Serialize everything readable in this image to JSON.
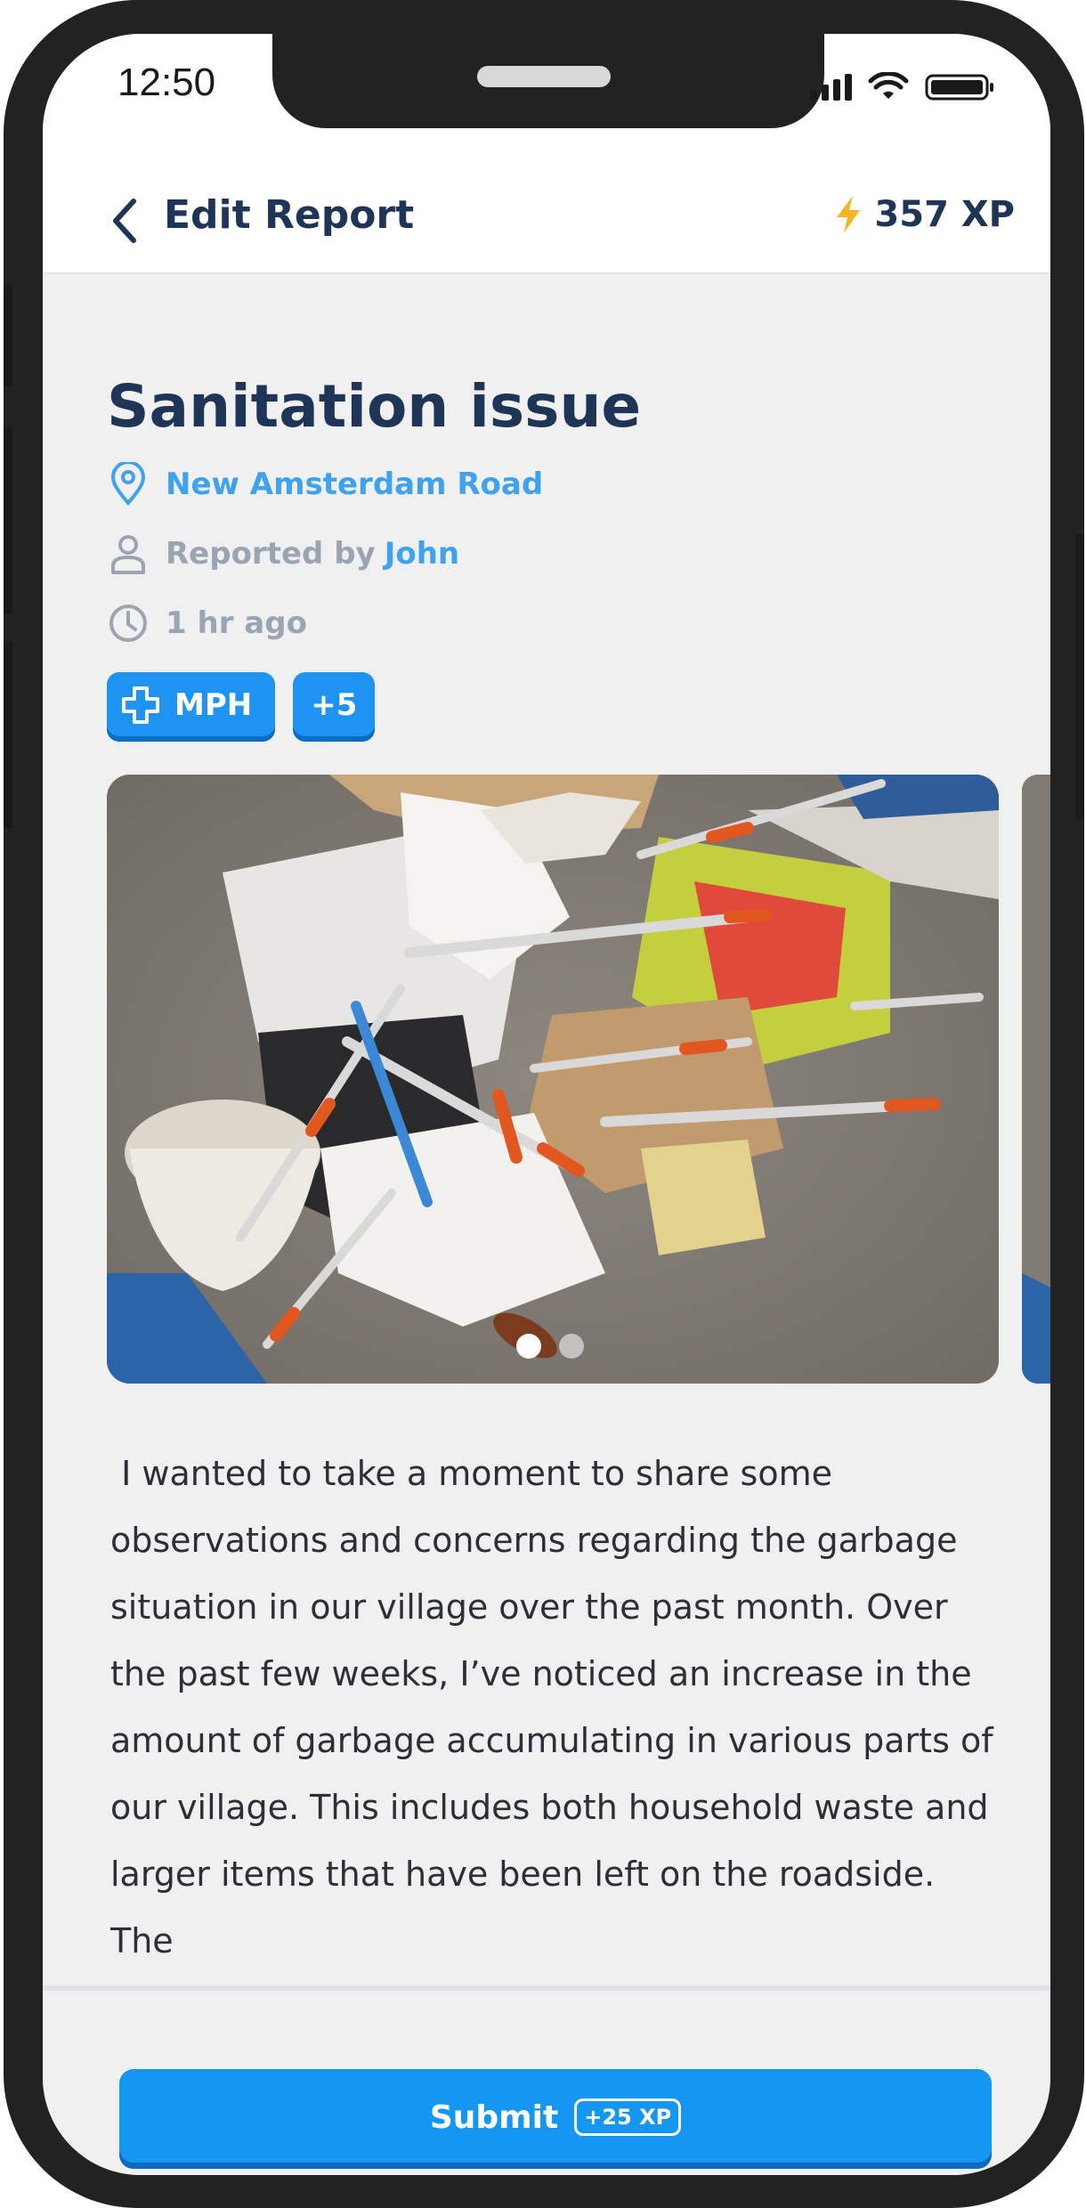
{
  "status_bar": {
    "time": "12:50"
  },
  "header": {
    "title": "Edit Report",
    "xp": "357 XP"
  },
  "report": {
    "title": "Sanitation issue",
    "location": "New Amsterdam Road",
    "reported_by_prefix": "Reported by",
    "reporter": "John",
    "time_ago": "1 hr ago",
    "tags": [
      {
        "label": "MPH",
        "icon": "medical-cross-icon"
      },
      {
        "label": "+5"
      }
    ],
    "photos_count": 2,
    "active_photo": 1,
    "description": " I wanted to take a moment to share some observations and concerns regarding the garbage situation in our village over the past month. Over the past few weeks, I’ve noticed an increase in the amount of garbage accumulating in various parts of our village. This includes both household waste and larger items that have been left on the roadside. The"
  },
  "footer": {
    "submit_label": "Submit",
    "submit_badge": "+25 XP"
  },
  "colors": {
    "primary": "#1597f1",
    "title": "#1f3558",
    "link": "#3ea2ef",
    "muted": "#9aa5b4",
    "xp_bolt": "#f4b524"
  }
}
